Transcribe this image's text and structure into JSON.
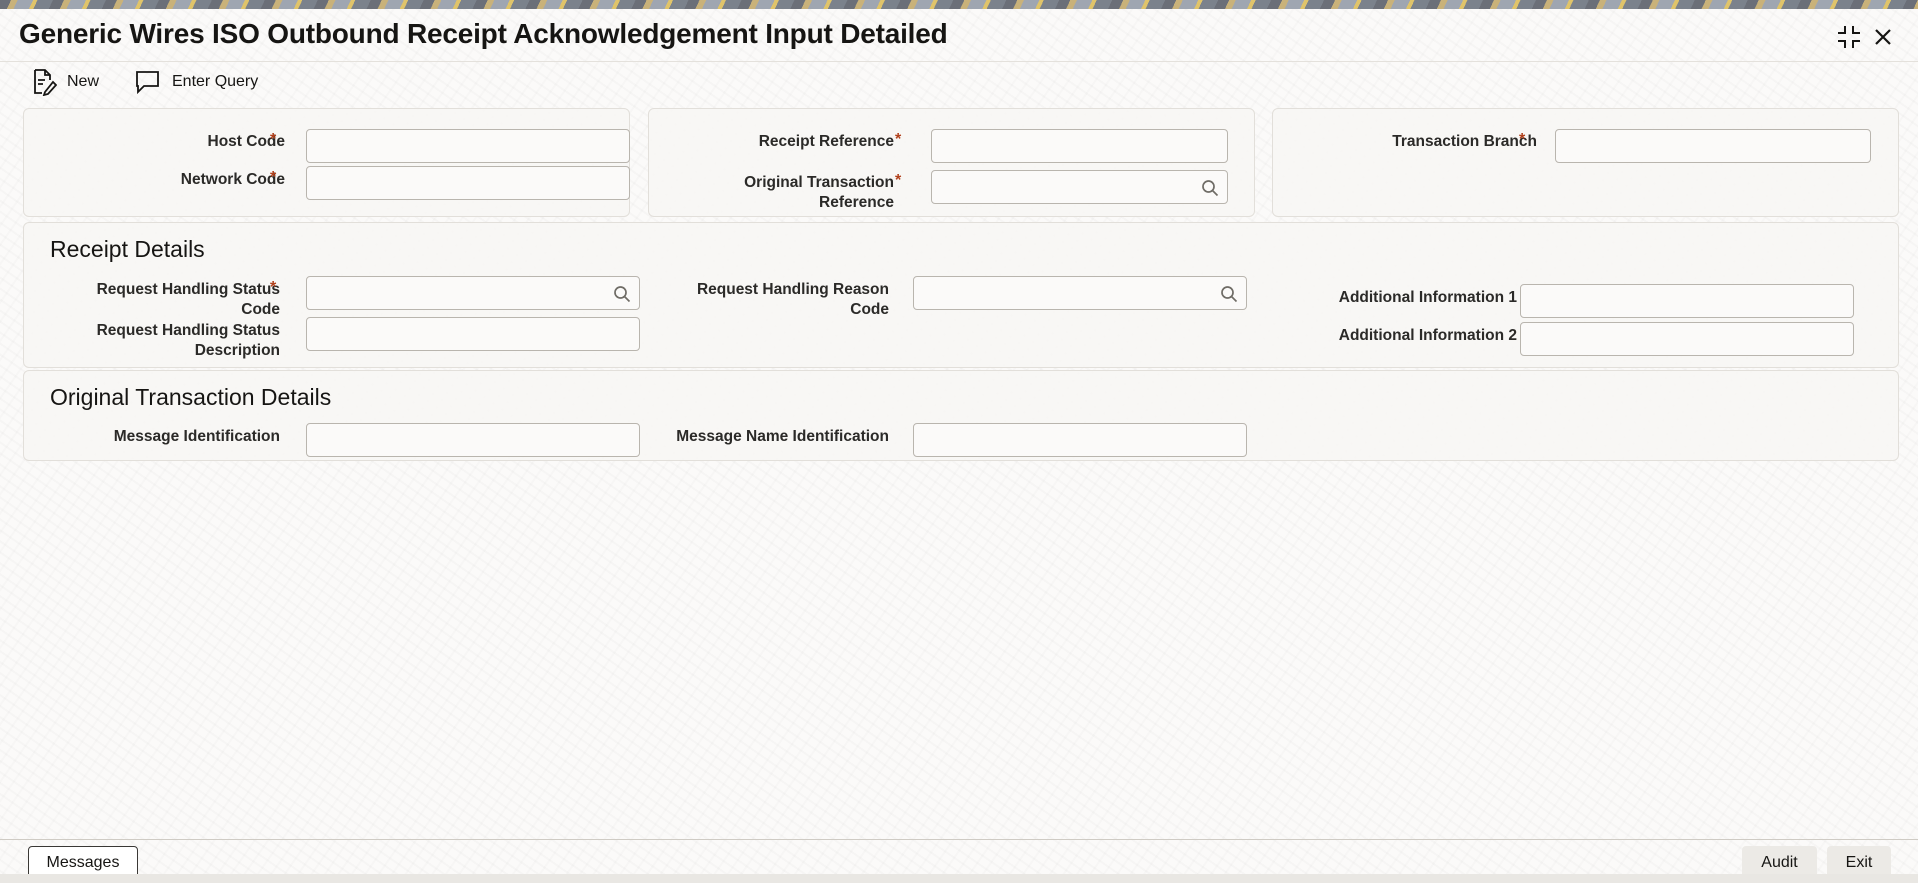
{
  "window": {
    "title": "Generic Wires ISO Outbound Receipt Acknowledgement Input Detailed"
  },
  "toolbar": {
    "new_label": "New",
    "enter_query_label": "Enter Query"
  },
  "header_panel": {
    "host_code_label": "Host Code",
    "network_code_label": "Network Code",
    "receipt_reference_label": "Receipt Reference",
    "original_txn_ref_label_line1": "Original Transaction",
    "original_txn_ref_label_line2": "Reference",
    "transaction_branch_label": "Transaction Branch",
    "required_marker": "*",
    "host_code_value": "",
    "network_code_value": "",
    "receipt_reference_value": "",
    "original_txn_ref_value": "",
    "transaction_branch_value": ""
  },
  "receipt_details": {
    "title": "Receipt Details",
    "status_code_label_line1": "Request Handling Status",
    "status_code_label_line2": "Code",
    "status_desc_label_line1": "Request Handling Status",
    "status_desc_label_line2": "Description",
    "reason_code_label_line1": "Request Handling Reason",
    "reason_code_label_line2": "Code",
    "addl_info_1_label": "Additional Information 1",
    "addl_info_2_label": "Additional Information 2",
    "status_code_value": "",
    "status_desc_value": "",
    "reason_code_value": "",
    "addl_info_1_value": "",
    "addl_info_2_value": ""
  },
  "original_txn_details": {
    "title": "Original Transaction Details",
    "message_id_label": "Message Identification",
    "message_name_id_label": "Message Name Identification",
    "message_id_value": "",
    "message_name_id_value": ""
  },
  "footer": {
    "messages_label": "Messages",
    "audit_label": "Audit",
    "exit_label": "Exit"
  },
  "colors": {
    "required": "#b1401b",
    "panel_bg": "#f7f6f4",
    "border": "#b9b5ae"
  },
  "icons": [
    "maximize-icon",
    "close-icon",
    "new-document-icon",
    "enter-query-icon",
    "search-icon"
  ]
}
